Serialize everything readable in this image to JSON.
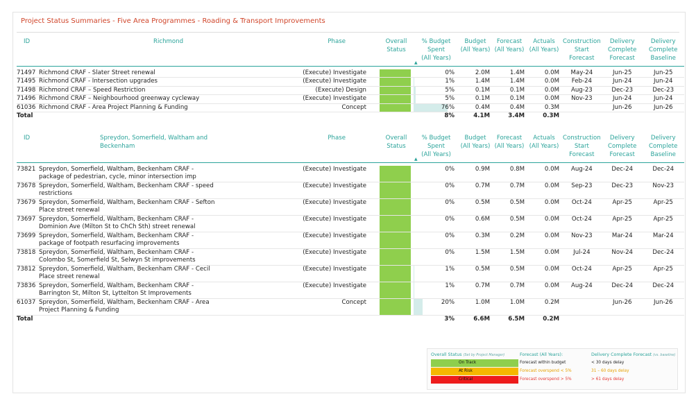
{
  "title": "Project Status Summaries - Five Area Programmes - Roading & Transport Improvements",
  "colors": {
    "title": "#d0452a",
    "header": "#2aa39a",
    "on_track": "#8fcf4d",
    "at_risk": "#f5b800",
    "critical": "#ee1c1c",
    "pct_bar": "#d4ecea",
    "at_risk_text": "#e6a100",
    "critical_text": "#e53935"
  },
  "headers": {
    "id": "ID",
    "phase": "Phase",
    "overall_status_1": "Overall",
    "overall_status_2": "Status",
    "pct_1": "% Budget Spent",
    "pct_2": "(All Years)",
    "budget_1": "Budget",
    "budget_2": "(All Years)",
    "forecast_1": "Forecast",
    "forecast_2": "(All Years)",
    "actuals_1": "Actuals",
    "actuals_2": "(All Years)",
    "cs_1": "Construction",
    "cs_2": "Start",
    "cs_3": "Forecast",
    "dcf_1": "Delivery",
    "dcf_2": "Complete",
    "dcf_3": "Forecast",
    "dcb_1": "Delivery",
    "dcb_2": "Complete",
    "dcb_3": "Baseline",
    "sort_icon": "sort-ascending-icon",
    "sort_glyph": "▲"
  },
  "sections": [
    {
      "name": "Richmond",
      "rows": [
        {
          "id": "71497",
          "name": "Richmond CRAF - Slater Street renewal",
          "phase": "(Execute) Investigate",
          "status": "on_track",
          "pct": 0,
          "pct_label": "0%",
          "budget": "2.0M",
          "forecast": "1.4M",
          "actuals": "0.0M",
          "cs": "May-24",
          "dcf": "Jun-25",
          "dcb": "Jun-25"
        },
        {
          "id": "71495",
          "name": "Richmond CRAF - Intersection upgrades",
          "phase": "(Execute) Investigate",
          "status": "on_track",
          "pct": 1,
          "pct_label": "1%",
          "budget": "1.4M",
          "forecast": "1.4M",
          "actuals": "0.0M",
          "cs": "Feb-24",
          "dcf": "Jun-24",
          "dcb": "Jun-24"
        },
        {
          "id": "71498",
          "name": "Richmond CRAF – Speed Restriction",
          "phase": "(Execute) Design",
          "status": "on_track",
          "pct": 5,
          "pct_label": "5%",
          "budget": "0.1M",
          "forecast": "0.1M",
          "actuals": "0.0M",
          "cs": "Aug-23",
          "dcf": "Dec-23",
          "dcb": "Dec-23"
        },
        {
          "id": "71496",
          "name": "Richmond CRAF – Neighbourhood greenway cycleway",
          "phase": "(Execute) Investigate",
          "status": "on_track",
          "pct": 5,
          "pct_label": "5%",
          "budget": "0.1M",
          "forecast": "0.1M",
          "actuals": "0.0M",
          "cs": "Nov-23",
          "dcf": "Jun-24",
          "dcb": "Jun-24"
        },
        {
          "id": "61036",
          "name": "Richmond CRAF - Area Project Planning & Funding",
          "phase": "Concept",
          "status": "on_track",
          "pct": 76,
          "pct_label": "76%",
          "budget": "0.4M",
          "forecast": "0.4M",
          "actuals": "0.3M",
          "cs": "",
          "dcf": "Jun-26",
          "dcb": "Jun-26"
        }
      ],
      "total": {
        "label": "Total",
        "pct": "8%",
        "budget": "4.1M",
        "forecast": "3.4M",
        "actuals": "0.3M"
      }
    },
    {
      "name": "Spreydon, Somerfield, Waltham and Beckenham",
      "rows": [
        {
          "id": "73821",
          "name": "Spreydon, Somerfield, Waltham, Beckenham CRAF - package of pedestrian, cycle, minor intersection imp",
          "phase": "(Execute) Investigate",
          "status": "on_track",
          "pct": 0,
          "pct_label": "0%",
          "budget": "0.9M",
          "forecast": "0.8M",
          "actuals": "0.0M",
          "cs": "Aug-24",
          "dcf": "Dec-24",
          "dcb": "Dec-24"
        },
        {
          "id": "73678",
          "name": "Spreydon, Somerfield, Waltham, Beckenham CRAF - speed restrictions",
          "phase": "(Execute) Investigate",
          "status": "on_track",
          "pct": 0,
          "pct_label": "0%",
          "budget": "0.7M",
          "forecast": "0.7M",
          "actuals": "0.0M",
          "cs": "Sep-23",
          "dcf": "Dec-23",
          "dcb": "Nov-23"
        },
        {
          "id": "73679",
          "name": "Spreydon, Somerfield, Waltham, Beckenham CRAF - Sefton Place street renewal",
          "phase": "(Execute) Investigate",
          "status": "on_track",
          "pct": 0,
          "pct_label": "0%",
          "budget": "0.5M",
          "forecast": "0.5M",
          "actuals": "0.0M",
          "cs": "Oct-24",
          "dcf": "Apr-25",
          "dcb": "Apr-25"
        },
        {
          "id": "73697",
          "name": "Spreydon, Somerfield, Waltham, Beckenham CRAF - Dominion Ave (Milton St to ChCh Sth) street renewal",
          "phase": "(Execute) Investigate",
          "status": "on_track",
          "pct": 0,
          "pct_label": "0%",
          "budget": "0.6M",
          "forecast": "0.5M",
          "actuals": "0.0M",
          "cs": "Oct-24",
          "dcf": "Apr-25",
          "dcb": "Apr-25"
        },
        {
          "id": "73699",
          "name": "Spreydon, Somerfield, Waltham, Beckenham CRAF - package of footpath resurfacing improvements",
          "phase": "(Execute) Investigate",
          "status": "on_track",
          "pct": 0,
          "pct_label": "0%",
          "budget": "0.3M",
          "forecast": "0.2M",
          "actuals": "0.0M",
          "cs": "Nov-23",
          "dcf": "Mar-24",
          "dcb": "Mar-24"
        },
        {
          "id": "73818",
          "name": "Spreydon, Somerfield, Waltham, Beckenham CRAF - Colombo St, Somerfield St, Selwyn St improvements",
          "phase": "(Execute) Investigate",
          "status": "on_track",
          "pct": 0,
          "pct_label": "0%",
          "budget": "1.5M",
          "forecast": "1.5M",
          "actuals": "0.0M",
          "cs": "Jul-24",
          "dcf": "Nov-24",
          "dcb": "Dec-24"
        },
        {
          "id": "73812",
          "name": "Spreydon, Somerfield, Waltham, Beckenham CRAF - Cecil Place street renewal",
          "phase": "(Execute) Investigate",
          "status": "on_track",
          "pct": 1,
          "pct_label": "1%",
          "budget": "0.5M",
          "forecast": "0.5M",
          "actuals": "0.0M",
          "cs": "Oct-24",
          "dcf": "Apr-25",
          "dcb": "Apr-25"
        },
        {
          "id": "73836",
          "name": "Spreydon, Somerfield, Waltham, Beckenham CRAF - Barrington St, Milton St, Lyttelton St Improvements",
          "phase": "(Execute) Investigate",
          "status": "on_track",
          "pct": 1,
          "pct_label": "1%",
          "budget": "0.7M",
          "forecast": "0.7M",
          "actuals": "0.0M",
          "cs": "Aug-24",
          "dcf": "Dec-24",
          "dcb": "Dec-24"
        },
        {
          "id": "61037",
          "name": "Spreydon, Somerfield, Waltham, Beckenham CRAF - Area Project Planning & Funding",
          "phase": "Concept",
          "status": "on_track",
          "pct": 20,
          "pct_label": "20%",
          "budget": "1.0M",
          "forecast": "1.0M",
          "actuals": "0.2M",
          "cs": "",
          "dcf": "Jun-26",
          "dcb": "Jun-26"
        }
      ],
      "total": {
        "label": "Total",
        "pct": "3%",
        "budget": "6.6M",
        "forecast": "6.5M",
        "actuals": "0.2M"
      }
    }
  ],
  "legend": {
    "status_title": "Overall Status",
    "status_note": "(Set by Project Manager)",
    "forecast_title": "Forecast (All Years):",
    "delivery_title": "Delivery Complete Forecast",
    "delivery_note": "(vs. baseline)",
    "items": [
      {
        "key": "on_track",
        "label": "On Track",
        "forecast": "Forecast within budget",
        "delivery": "< 30 days delay"
      },
      {
        "key": "at_risk",
        "label": "At Risk",
        "forecast": "Forecast overspend < 5%",
        "delivery": "31 – 60 days delay"
      },
      {
        "key": "critical",
        "label": "Critical",
        "forecast": "Forecast overspend > 5%",
        "delivery": "> 61 days delay"
      }
    ]
  }
}
